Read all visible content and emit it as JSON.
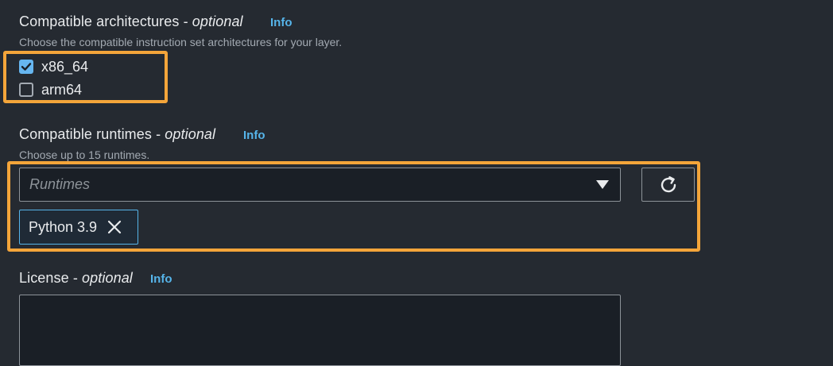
{
  "architectures": {
    "label": "Compatible architectures -",
    "optional": "optional",
    "info": "Info",
    "description": "Choose the compatible instruction set architectures for your layer.",
    "options": [
      {
        "label": "x86_64",
        "checked": true
      },
      {
        "label": "arm64",
        "checked": false
      }
    ]
  },
  "runtimes": {
    "label": "Compatible runtimes -",
    "optional": "optional",
    "info": "Info",
    "description": "Choose up to 15 runtimes.",
    "placeholder": "Runtimes",
    "selected": [
      {
        "label": "Python 3.9"
      }
    ]
  },
  "license": {
    "label": "License -",
    "optional": "optional",
    "info": "Info",
    "value": ""
  },
  "colors": {
    "background": "#252a31",
    "highlight": "#f4a53a",
    "link": "#56b4e9",
    "checkbox_checked": "#66b6f0"
  },
  "icons": {
    "select_caret": "caret-down-icon",
    "refresh": "refresh-icon",
    "dismiss": "close-icon",
    "check": "check-icon"
  }
}
